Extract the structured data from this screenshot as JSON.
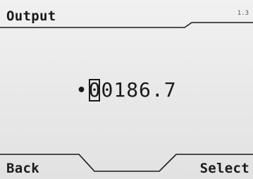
{
  "header": {
    "title": "Output",
    "page_indicator": "1.3"
  },
  "main": {
    "value_sign": "•",
    "value_digits": [
      "0",
      "0",
      "1",
      "8",
      "6",
      ".",
      "7"
    ],
    "cursor_index": 0
  },
  "softkeys": {
    "left_label": "Back",
    "right_label": "Select"
  }
}
